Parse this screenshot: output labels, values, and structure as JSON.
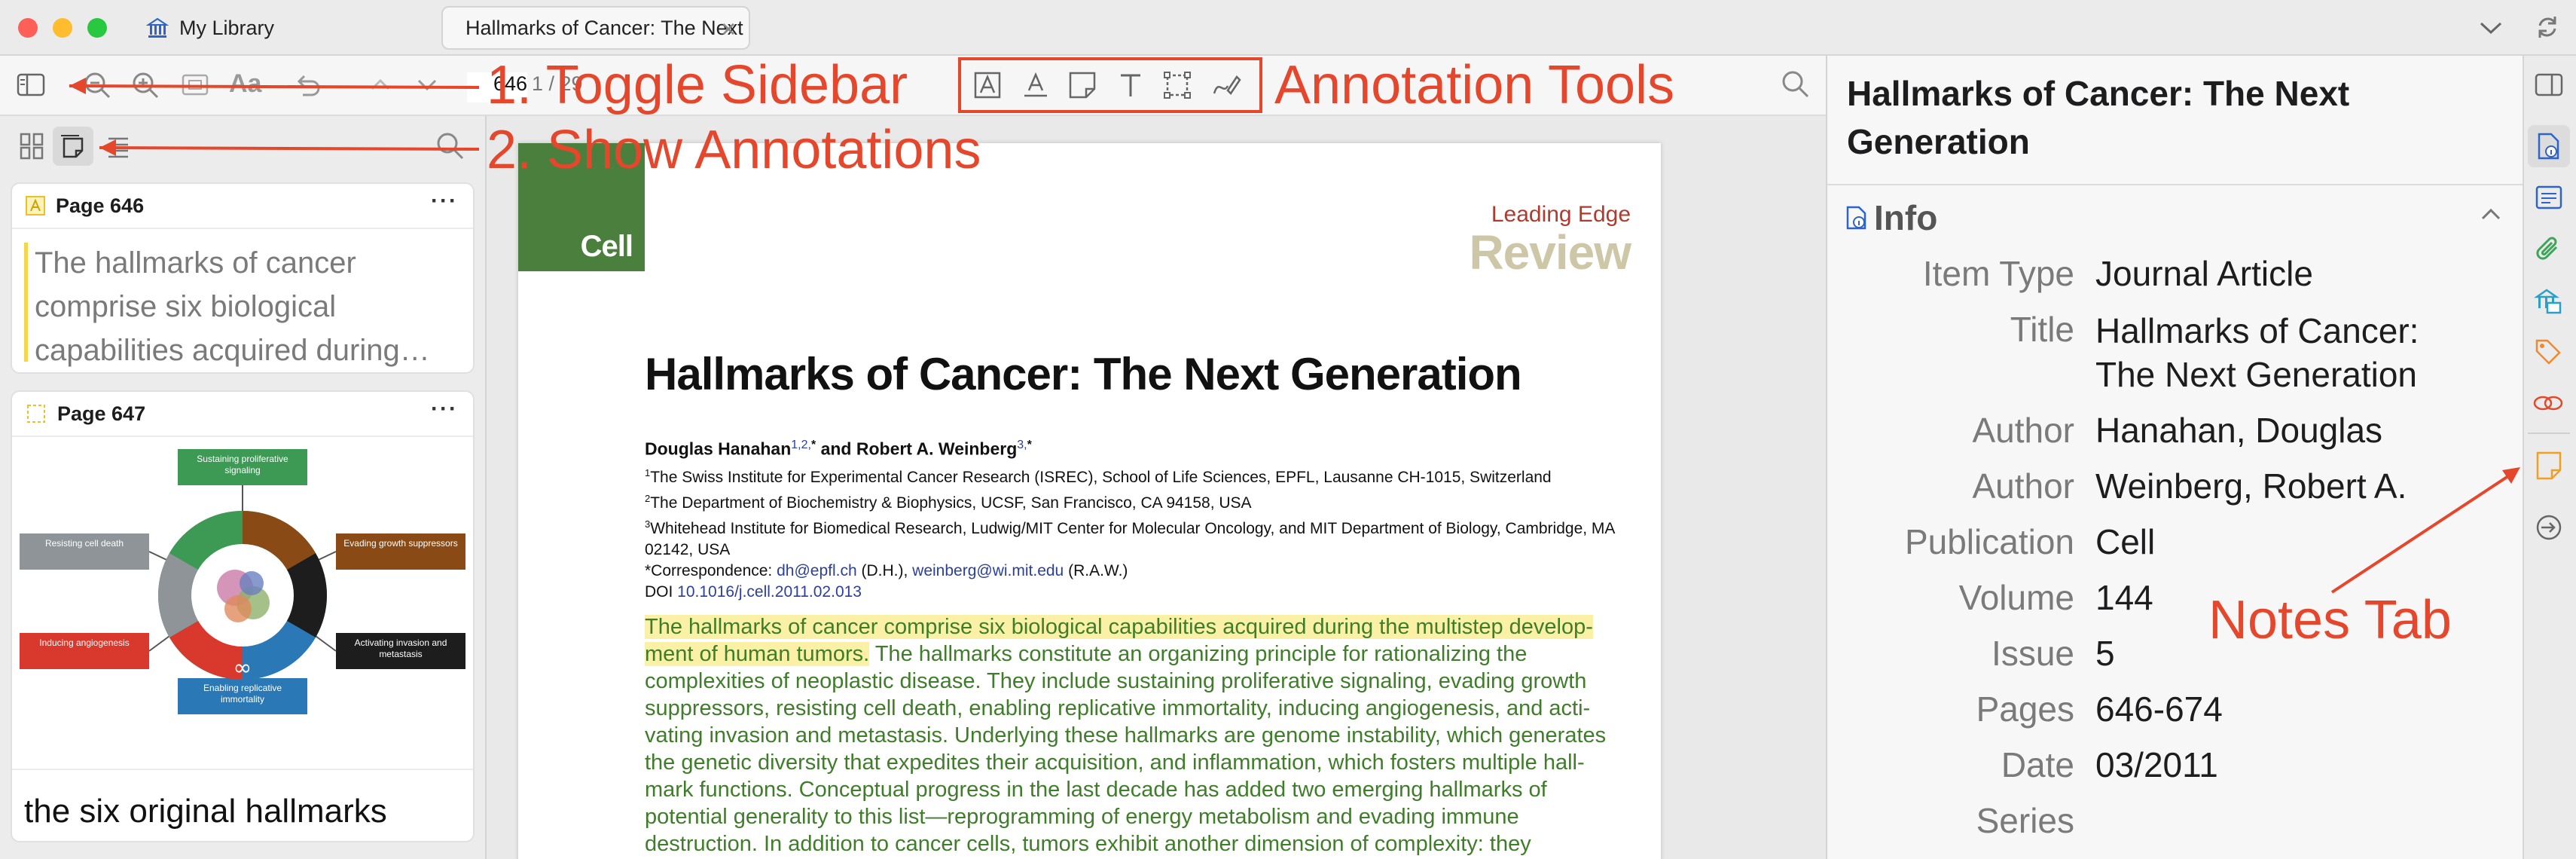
{
  "window": {
    "library_tab": "My Library",
    "document_tab": "Hallmarks of Cancer: The Next Generation"
  },
  "toolbar": {
    "page_number": "646",
    "page_total": "1 / 29"
  },
  "sidebar": {
    "annotations": [
      {
        "page_label": "Page 646",
        "type": "highlight",
        "text": "The hallmarks of cancer comprise six biological capabilities acquired during…",
        "color": "#f5d64a"
      },
      {
        "page_label": "Page 647",
        "type": "image",
        "comment": "the six original hallmarks",
        "color": "#f5d64a",
        "figure": {
          "top": "Sustaining proliferative signaling",
          "left_top": "Resisting cell death",
          "right_top": "Evading growth suppressors",
          "left_bottom": "Inducing angiogenesis",
          "right_bottom": "Activating invasion and metastasis",
          "bottom": "Enabling replicative immortality"
        }
      }
    ]
  },
  "pdf": {
    "journal_logo": "Cell",
    "section_top": "Leading Edge",
    "section_bottom": "Review",
    "title": "Hallmarks of Cancer: The Next Generation",
    "authors_line1": "Douglas Hanahan",
    "authors_sup1": "1,2,",
    "authors_star1": "*",
    "authors_and": " and Robert A. Weinberg",
    "authors_sup2": "3,",
    "authors_star2": "*",
    "affiliations": [
      {
        "sup": "1",
        "text": "The Swiss Institute for Experimental Cancer Research (ISREC), School of Life Sciences, EPFL, Lausanne CH-1015, Switzerland"
      },
      {
        "sup": "2",
        "text": "The Department of Biochemistry & Biophysics, UCSF, San Francisco, CA 94158, USA"
      },
      {
        "sup": "3",
        "text": "Whitehead Institute for Biomedical Research, Ludwig/MIT Center for Molecular Oncology, and MIT Department of Biology, Cambridge, MA 02142, USA"
      }
    ],
    "correspondence_prefix": "*Correspondence: ",
    "email1": "dh@epfl.ch",
    "email1_suffix": " (D.H.), ",
    "email2": "weinberg@wi.mit.edu",
    "email2_suffix": " (R.A.W.)",
    "doi_prefix": "DOI ",
    "doi": "10.1016/j.cell.2011.02.013",
    "abstract_lines": [
      {
        "hl": "The hallmarks of cancer comprise six biological capabilities acquired during the multistep develop-",
        "rest": ""
      },
      {
        "hl": "ment of human tumors.",
        "rest": " The hallmarks constitute an organizing principle for rationalizing the"
      },
      {
        "hl": "",
        "rest": "complexities of neoplastic disease. They include sustaining proliferative signaling, evading growth"
      },
      {
        "hl": "",
        "rest": "suppressors, resisting cell death, enabling replicative immortality, inducing angiogenesis, and acti-"
      },
      {
        "hl": "",
        "rest": "vating invasion and metastasis. Underlying these hallmarks are genome instability, which generates"
      },
      {
        "hl": "",
        "rest": "the genetic diversity that expedites their acquisition, and inflammation, which fosters multiple hall-"
      },
      {
        "hl": "",
        "rest": "mark functions. Conceptual progress in the last decade has added two emerging hallmarks of"
      },
      {
        "hl": "",
        "rest": "potential generality to this list—reprogramming of energy metabolism and evading immune"
      },
      {
        "hl": "",
        "rest": "destruction. In addition to cancer cells, tumors exhibit another dimension of complexity: they"
      }
    ]
  },
  "item_pane": {
    "header_title": "Hallmarks of Cancer: The Next Generation",
    "section_title": "Info",
    "fields": [
      {
        "label": "Item Type",
        "value": "Journal Article"
      },
      {
        "label": "Title",
        "value": "Hallmarks of Cancer: The Next Generation"
      },
      {
        "label": "Author",
        "value": "Hanahan, Douglas"
      },
      {
        "label": "Author",
        "value": "Weinberg, Robert A."
      },
      {
        "label": "Publication",
        "value": "Cell"
      },
      {
        "label": "Volume",
        "value": "144"
      },
      {
        "label": "Issue",
        "value": "5"
      },
      {
        "label": "Pages",
        "value": "646-674"
      },
      {
        "label": "Date",
        "value": "03/2011"
      },
      {
        "label": "Series",
        "value": ""
      }
    ]
  },
  "callouts": {
    "toggle_sidebar": "1. Toggle Sidebar",
    "show_annotations": "2. Show Annotations",
    "annotation_tools": "Annotation Tools",
    "notes_tab": "Notes Tab"
  },
  "colors": {
    "callout_red": "#e5472c",
    "highlight_yellow": "#faf0a6",
    "abstract_green": "#3f7d2a",
    "cell_logo_green": "#4b7f3d",
    "review_beige": "#cdc7a8",
    "leading_edge_red": "#b03a2e"
  }
}
